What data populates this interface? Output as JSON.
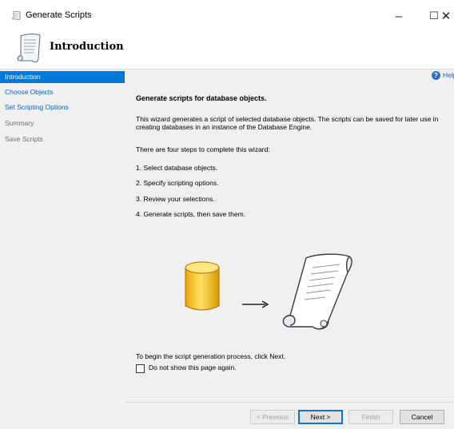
{
  "window": {
    "title": "Generate Scripts",
    "minimize_glyph": "–",
    "maximize_glyph": "☐",
    "close_glyph": "✕"
  },
  "header": {
    "title": "Introduction"
  },
  "sidebar": {
    "items": [
      {
        "label": "Introduction",
        "state": "active"
      },
      {
        "label": "Choose Objects",
        "state": "link"
      },
      {
        "label": "Set Scripting Options",
        "state": "link"
      },
      {
        "label": "Summary",
        "state": "disabled"
      },
      {
        "label": "Save Scripts",
        "state": "disabled"
      }
    ]
  },
  "content": {
    "help_label": "Help",
    "heading": "Generate scripts for database objects.",
    "description": "This wizard generates a script of selected database objects. The scripts can be saved for later use in creating databases in an instance of the Database Engine.",
    "steps_intro": "There are four steps to complete this wizard:",
    "steps": [
      "1. Select database objects.",
      "2. Specify scripting options.",
      "3. Review your selections.",
      "4. Generate scripts, then save them."
    ],
    "begin_text": "To begin the script generation process, click Next.",
    "checkbox_label": "Do not show this page again.",
    "checkbox_checked": false
  },
  "footer": {
    "previous_label": "< Previous",
    "next_label": "Next >",
    "finish_label": "Finish",
    "cancel_label": "Cancel"
  },
  "colors": {
    "active_bg": "#0078d7",
    "link": "#0066cc",
    "disabled": "#6d6d6d",
    "db_yellow": "#f5c518"
  },
  "icons": [
    "script-scroll-icon",
    "help-icon",
    "database-icon",
    "arrow-right-icon",
    "scroll-icon"
  ]
}
